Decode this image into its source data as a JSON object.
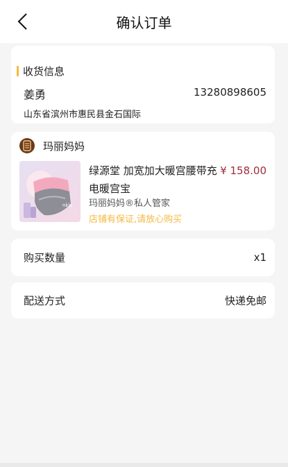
{
  "navbar": {
    "title": "确认订单",
    "back_icon": "chevron-left-icon"
  },
  "address": {
    "section_title": "收货信息",
    "name": "姜勇",
    "phone": "13280898605",
    "detail": "山东省滨州市惠民县金石国际",
    "accent_color": "#f5b942"
  },
  "product": {
    "shop_name": "玛丽妈妈",
    "shop_logo_icon": "shop-logo-icon",
    "title": "绿源堂 加宽加大暖宫腰带充电暖宫宝",
    "price": "¥ 158.00",
    "subtitle": "玛丽妈妈®私人管家",
    "guarantee": "店铺有保证,请放心购买",
    "price_color": "#9e2d3a",
    "guarantee_color": "#f5b942"
  },
  "quantity": {
    "label": "购买数量",
    "value": "x1"
  },
  "shipping": {
    "label": "配送方式",
    "value": "快递免邮"
  }
}
